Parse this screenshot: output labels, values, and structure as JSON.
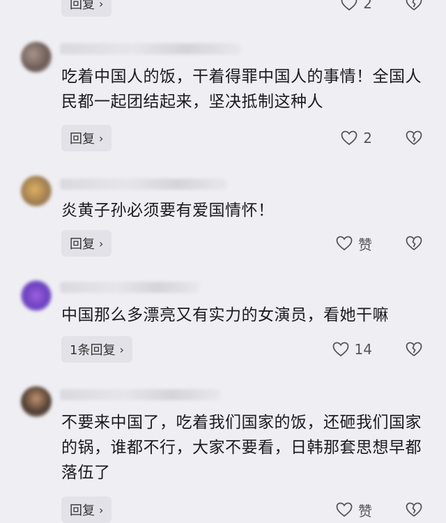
{
  "top": {
    "reply_label": "回复",
    "like_count": "2"
  },
  "comments": [
    {
      "text": "吃着中国人的饭，干着得罪中国人的事情！全国人民都一起团结起来，坚决抵制这种人",
      "reply_label": "回复",
      "like_count": "2"
    },
    {
      "text": "炎黄子孙必须要有爱国情怀！",
      "reply_label": "回复",
      "like_count": "赞"
    },
    {
      "text": "中国那么多漂亮又有实力的女演员，看她干嘛",
      "reply_label": "1条回复",
      "like_count": "14"
    },
    {
      "text": "不要来中国了，吃着我们国家的饭，还砸我们国家的锅，谁都不行，大家不要看，日韩那套思想早都落伍了",
      "reply_label": "回复",
      "like_count": "赞"
    }
  ],
  "icons": {
    "like": "heart-outline-icon",
    "dislike": "broken-heart-icon",
    "chevron": "chevron-right-icon"
  },
  "colors": {
    "background": "#efeef3",
    "button": "#e3e2e8",
    "text": "#1b1b1f"
  }
}
